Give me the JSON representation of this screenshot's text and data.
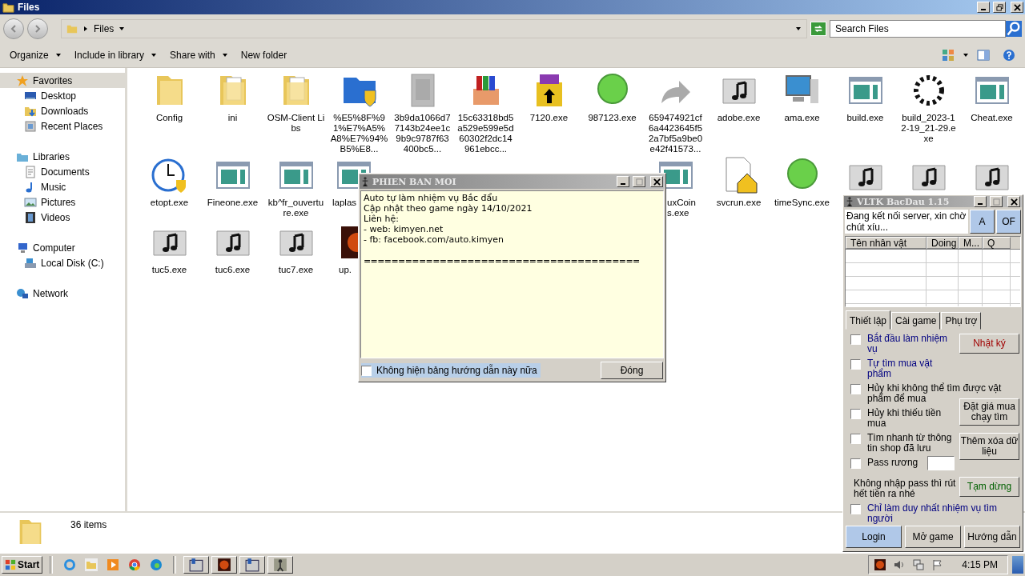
{
  "window": {
    "title": "Files"
  },
  "address": {
    "path": "Files",
    "search_placeholder": "Search Files"
  },
  "toolbar": [
    {
      "label": "Organize",
      "dropdown": true
    },
    {
      "label": "Include in library",
      "dropdown": true
    },
    {
      "label": "Share with",
      "dropdown": true
    },
    {
      "label": "New folder",
      "dropdown": false
    }
  ],
  "sidebar": {
    "items": [
      {
        "label": "Favorites",
        "selected": true,
        "children": [
          {
            "label": "Desktop",
            "selected": false
          },
          {
            "label": "Downloads",
            "selected": false
          },
          {
            "label": "Recent Places",
            "selected": false
          }
        ]
      },
      {
        "label": "Libraries",
        "selected": false,
        "children": [
          {
            "label": "Documents",
            "selected": false
          },
          {
            "label": "Music",
            "selected": false
          },
          {
            "label": "Pictures",
            "selected": false
          },
          {
            "label": "Videos",
            "selected": false
          }
        ]
      },
      {
        "label": "Computer",
        "selected": false,
        "children": [
          {
            "label": "Local Disk (C:)",
            "selected": false
          }
        ]
      },
      {
        "label": "Network",
        "selected": false
      }
    ]
  },
  "files": [
    [
      {
        "name": "Config"
      },
      {
        "name": "ini"
      },
      {
        "name": "OSM-Client Libs"
      },
      {
        "name": "%E5%8F%91%E7%A5%A8%E7%94%B5%E8..."
      },
      {
        "name": "3b9da1066d77143b24ee1c9b9c9787f63400bc5..."
      },
      {
        "name": "15c63318bd5a529e599e5d60302f2dc14961ebcc..."
      },
      {
        "name": "7120.exe"
      },
      {
        "name": "987123.exe"
      },
      {
        "name": "659474921cf6a4423645f52a7bf5a9be0e42f41573..."
      },
      {
        "name": "adobe.exe"
      },
      {
        "name": "ama.exe"
      },
      {
        "name": "build.exe"
      },
      {
        "name": "build_2023-12-19_21-29.exe"
      },
      {
        "name": "Cheat.exe"
      }
    ],
    [
      {
        "name": "etopt.exe"
      },
      {
        "name": "Fineone.exe"
      },
      {
        "name": "kb^fr_ouverture.exe"
      },
      {
        "name": "laplas"
      },
      {
        "name": "uxCoins.exe"
      },
      {
        "name": "svcrun.exe"
      },
      {
        "name": "timeSync.exe"
      },
      {
        "kind": "icon-only"
      },
      {
        "kind": "icon-only"
      },
      {
        "kind": "icon-only"
      }
    ],
    [
      {
        "name": "tuc5.exe"
      },
      {
        "name": "tuc6.exe"
      },
      {
        "name": "tuc7.exe"
      },
      {
        "name": "up."
      }
    ]
  ],
  "details": {
    "count": "36 items"
  },
  "dialog": {
    "title": "PHIEN BAN MOI",
    "lines": [
      "Auto tự làm nhiệm vụ Bắc đẩu",
      "Cập nhật theo game ngày 14/10/2021",
      "Liên hệ:",
      "- web: kimyen.net",
      "- fb: facebook.com/auto.kimyen"
    ],
    "separator": "========================================",
    "checkbox": {
      "label": "Không hiện bảng hướng dẫn này nữa",
      "checked": false
    },
    "button": "Đóng"
  },
  "tool": {
    "title": "VLTK BacDau 1.15",
    "status": "Đang kết nối server, xin chờ chút xíu...",
    "top_buttons": [
      "A",
      "OF"
    ],
    "table": {
      "columns": [
        "Tên nhân vật",
        "Doing",
        "M...",
        "Q"
      ]
    },
    "tabs": [
      {
        "label": "Thiết lập",
        "selected": true
      },
      {
        "label": "Cài game",
        "selected": false
      },
      {
        "label": "Phụ trợ",
        "selected": false
      }
    ],
    "options": [
      {
        "kind": "check",
        "label": "Bắt đầu làm nhiệm vụ",
        "checked": false,
        "color": "#000080"
      },
      {
        "kind": "check",
        "label": "Tự tìm mua vật phẩm",
        "checked": false,
        "color": "#000080"
      },
      {
        "kind": "check",
        "label": "Hủy khi không thể tìm được vật phẩm để mua",
        "checked": false,
        "color": "#000000"
      },
      {
        "kind": "check",
        "label": "Hủy khi thiếu tiền mua",
        "checked": false,
        "color": "#000000"
      },
      {
        "kind": "check",
        "label": "Tìm nhanh từ thông tin shop đã lưu",
        "checked": false,
        "color": "#000000"
      },
      {
        "kind": "field",
        "label": "Pass rương",
        "checked": false,
        "color": "#000000"
      },
      {
        "kind": "note",
        "label": "Không nhập pass thì rút hết tiền ra nhé",
        "color": "#000000"
      },
      {
        "kind": "check",
        "label": "Chỉ làm duy nhất nhiệm vụ tìm người",
        "checked": false,
        "color": "#000080"
      }
    ],
    "side_buttons": [
      {
        "label": "Nhật ký",
        "color": "#a00000"
      },
      {
        "label": "Đặt giá mua chạy tìm",
        "color": "#000000"
      },
      {
        "label": "Thêm xóa dữ liệu",
        "color": "#000000"
      },
      {
        "label": "Tạm dừng",
        "color": "#006000"
      }
    ],
    "bottom_buttons": [
      {
        "label": "Login",
        "selected": true
      },
      {
        "label": "Mở game",
        "selected": false
      },
      {
        "label": "Hướng dẫn",
        "selected": false
      }
    ]
  },
  "taskbar": {
    "start": "Start",
    "clock": "4:15 PM"
  }
}
